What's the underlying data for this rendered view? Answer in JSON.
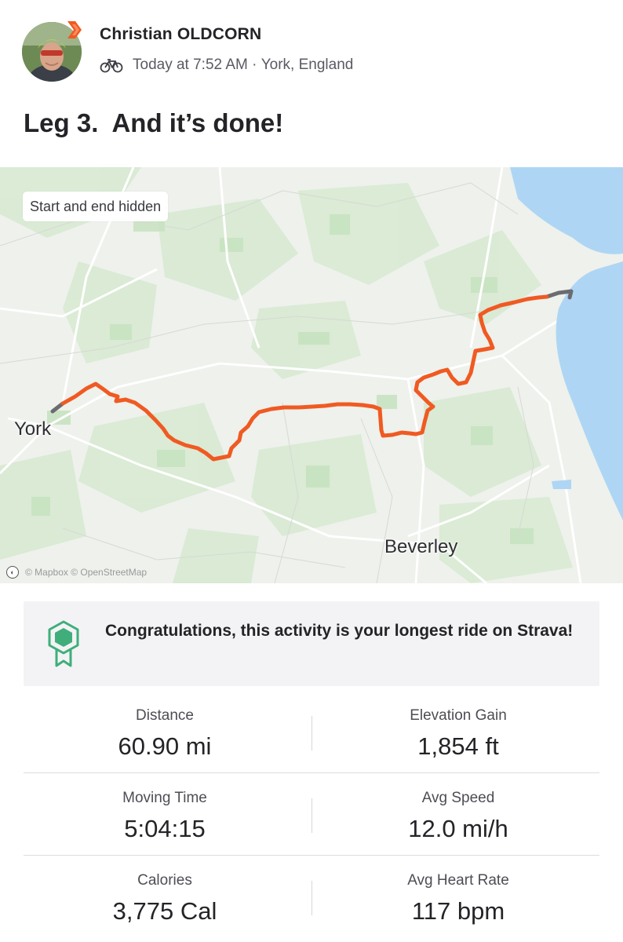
{
  "athlete": {
    "name": "Christian OLDCORN",
    "activity_time": "Today at 7:52 AM",
    "separator": " · ",
    "location": "York, England"
  },
  "activity": {
    "title": "Leg 3.  And it’s done!",
    "sport_icon": "bike-icon"
  },
  "map": {
    "privacy_label": "Start and end hidden",
    "places": [
      "York",
      "Beverley"
    ],
    "attribution": "© Mapbox © OpenStreetMap",
    "route_color": "#f05a22",
    "water_color": "#aed6f4"
  },
  "achievement": {
    "text": "Congratulations, this activity is your longest ride on Strava!",
    "icon": "award-hexagon-icon"
  },
  "stats": [
    {
      "left": {
        "label": "Distance",
        "value": "60.90 mi"
      },
      "right": {
        "label": "Elevation Gain",
        "value": "1,854 ft"
      }
    },
    {
      "left": {
        "label": "Moving Time",
        "value": "5:04:15"
      },
      "right": {
        "label": "Avg Speed",
        "value": "12.0 mi/h"
      }
    },
    {
      "left": {
        "label": "Calories",
        "value": "3,775 Cal"
      },
      "right": {
        "label": "Avg Heart Rate",
        "value": "117 bpm"
      }
    }
  ]
}
